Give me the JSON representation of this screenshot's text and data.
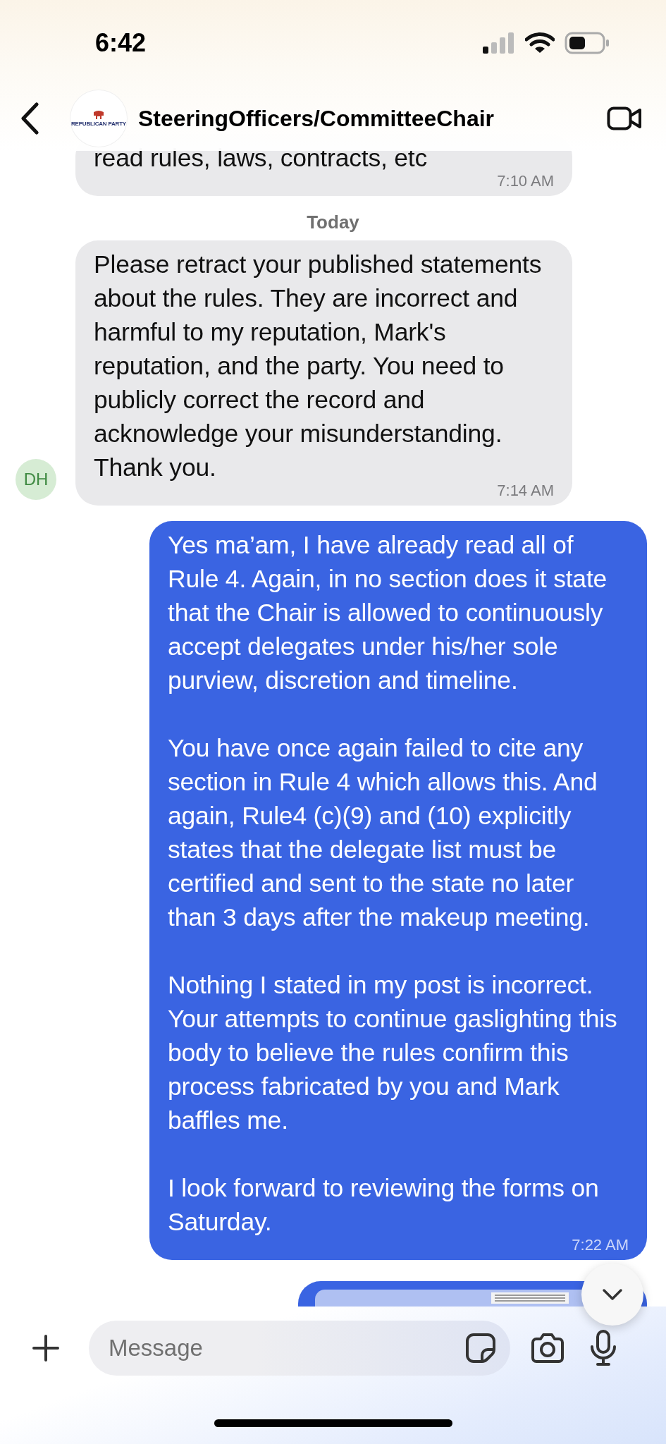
{
  "status_bar": {
    "time": "6:42"
  },
  "header": {
    "logo_text": "REPUBLICAN PARTY",
    "title": "SteeringOfficers/CommitteeChair"
  },
  "messages": [
    {
      "kind": "incoming",
      "paragraphs": [
        "read rules, laws, contracts, etc"
      ],
      "time": "7:10 AM"
    },
    {
      "kind": "date",
      "label": "Today"
    },
    {
      "kind": "incoming",
      "avatar": "DH",
      "paragraphs": [
        "Please retract your published statements about the rules. They are incorrect and harmful to my reputation, Mark's reputation, and the party. You need to publicly correct the record and acknowledge your misunderstanding. Thank you."
      ],
      "time": "7:14 AM"
    },
    {
      "kind": "outgoing",
      "paragraphs": [
        "Yes ma’am, I have already read all of Rule 4. Again, in no section does it state that the Chair is allowed to continuously accept delegates under his/her sole purview, discretion and timeline.",
        "You have once again failed to cite any section in Rule 4 which allows this. And again, Rule4 (c)(9) and (10) explicitly states that the delegate list must be certified and sent to the state no later than 3 days after the makeup meeting.",
        "Nothing I stated in my post is incorrect. Your attempts to continue gaslighting this body to believe the rules confirm this process fabricated by you and Mark baffles me.",
        "I look forward to reviewing the forms on Saturday."
      ],
      "time": "7:22 AM"
    },
    {
      "kind": "attachment"
    }
  ],
  "composer": {
    "placeholder": "Message"
  }
}
